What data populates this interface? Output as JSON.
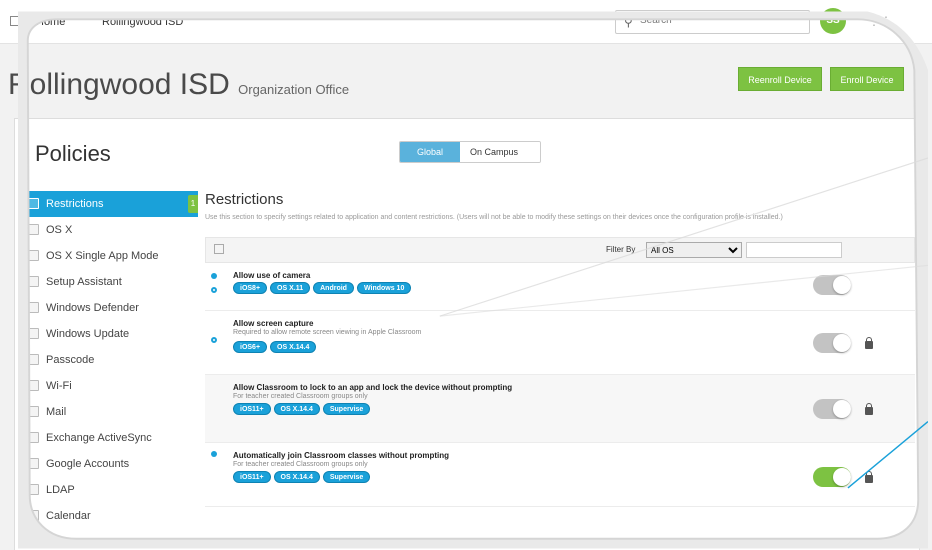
{
  "nav": {
    "home": "Home",
    "org": "Rollingwood ISD",
    "search_placeholder": "Search",
    "avatar": "SS"
  },
  "header": {
    "title": "Rollingwood ISD",
    "subtitle": "Organization Office",
    "reenroll_label": "Reenroll Device",
    "enroll_label": "Enroll Device"
  },
  "policies": {
    "title": "Policies",
    "scope_tabs": [
      "Global",
      "On Campus"
    ]
  },
  "sidebar": {
    "items": [
      {
        "label": "Restrictions",
        "badge": "1"
      },
      {
        "label": "OS X"
      },
      {
        "label": "OS X Single App Mode"
      },
      {
        "label": "Setup Assistant"
      },
      {
        "label": "Windows Defender"
      },
      {
        "label": "Windows Update"
      },
      {
        "label": "Passcode"
      },
      {
        "label": "Wi-Fi"
      },
      {
        "label": "Mail"
      },
      {
        "label": "Exchange ActiveSync"
      },
      {
        "label": "Google Accounts"
      },
      {
        "label": "LDAP"
      },
      {
        "label": "Calendar"
      }
    ]
  },
  "restrictions": {
    "title": "Restrictions",
    "description": "Use this section to specify settings related to application and content restrictions. (Users will not be able to modify these settings on their devices once the configuration profile is installed.)",
    "filter_label": "Filter By",
    "filter_value": "All OS",
    "rows": [
      {
        "name": "Allow use of camera",
        "hint": "",
        "tags": [
          "iOS8+",
          "OS X.11",
          "Android",
          "Windows 10"
        ],
        "enabled": false
      },
      {
        "name": "Allow screen capture",
        "hint": "Required to allow remote screen viewing in Apple Classroom",
        "tags": [
          "iOS6+",
          "OS X.14.4"
        ],
        "enabled": false
      },
      {
        "name": "Allow Classroom to lock to an app and lock the device without prompting",
        "hint": "For teacher created Classroom groups only",
        "tags": [
          "iOS11+",
          "OS X.14.4",
          "Supervise"
        ],
        "enabled": false
      },
      {
        "name": "Automatically join Classroom classes without prompting",
        "hint": "For teacher created Classroom groups only",
        "tags": [
          "iOS11+",
          "OS X.14.4",
          "Supervise"
        ],
        "enabled": true
      }
    ]
  },
  "colors": {
    "accent": "#1aa1d9",
    "green": "#7dc242",
    "toggle_off": "#c3c3c3"
  }
}
